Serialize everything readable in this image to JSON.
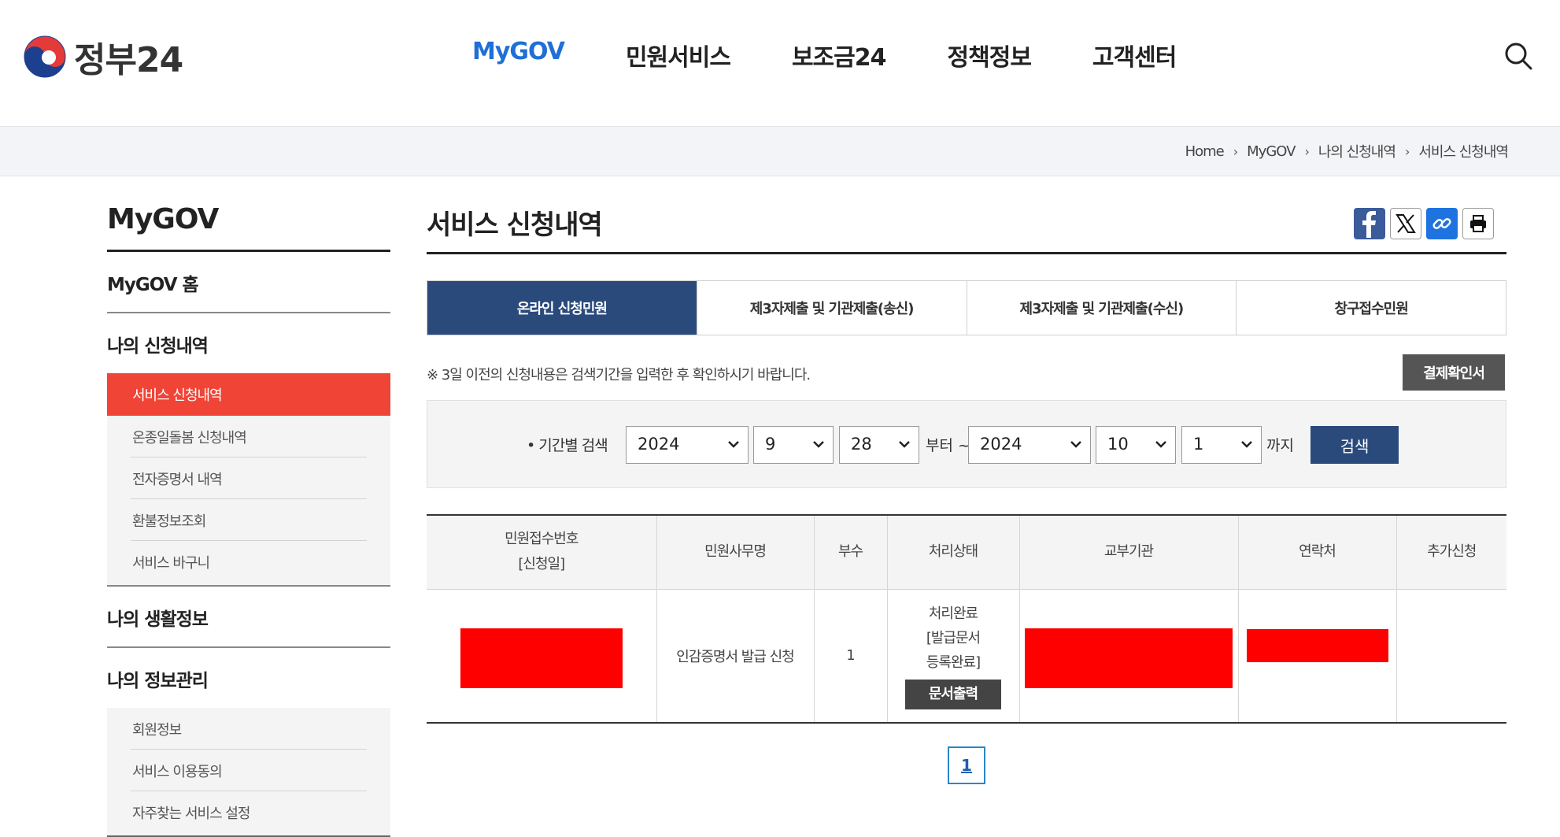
{
  "header": {
    "logo_text": "정부24",
    "nav": [
      "MyGOV",
      "민원서비스",
      "보조금24",
      "정책정보",
      "고객센터"
    ],
    "active_nav": "MyGOV"
  },
  "breadcrumb": [
    "Home",
    "MyGOV",
    "나의 신청내역",
    "서비스 신청내역"
  ],
  "sidebar": {
    "title": "MyGOV",
    "home": "MyGOV 홈",
    "group1": {
      "label": "나의 신청내역",
      "items": [
        "서비스 신청내역",
        "온종일돌봄 신청내역",
        "전자증명서 내역",
        "환불정보조회",
        "서비스 바구니"
      ]
    },
    "group2": {
      "label": "나의 생활정보"
    },
    "group3": {
      "label": "나의 정보관리",
      "items": [
        "회원정보",
        "서비스 이용동의",
        "자주찾는 서비스 설정"
      ]
    }
  },
  "main": {
    "title": "서비스 신청내역",
    "tabs": [
      "온라인 신청민원",
      "제3자제출 및 기관제출(송신)",
      "제3자제출 및 기관제출(수신)",
      "창구접수민원"
    ],
    "active_tab": 0,
    "notice": "※ 3일 이전의 신청내용은 검색기간을 입력한 후 확인하시기 바랍니다.",
    "receipt_button": "결제확인서",
    "filter": {
      "label": "• 기간별 검색",
      "from_year": "2024",
      "from_month": "9",
      "from_day": "28",
      "from_text": "부터 ~",
      "to_year": "2024",
      "to_month": "10",
      "to_day": "1",
      "to_text": "까지",
      "search_button": "검색"
    },
    "table": {
      "headers": [
        "민원접수번호",
        "[신청일]",
        "민원사무명",
        "부수",
        "처리상태",
        "교부기관",
        "연락처",
        "추가신청"
      ],
      "row": {
        "service_name": "인감증명서 발급 신청",
        "copies": "1",
        "status_line1": "처리완료",
        "status_line2": "[발급문서",
        "status_line3": "등록완료]",
        "print_button": "문서출력"
      }
    },
    "pagination": {
      "current": "1"
    }
  },
  "colors": {
    "brand_blue": "#1f6fd6",
    "navy": "#2a4a7c",
    "sidebar_active": "#f04436",
    "redaction": "#ff0000"
  }
}
